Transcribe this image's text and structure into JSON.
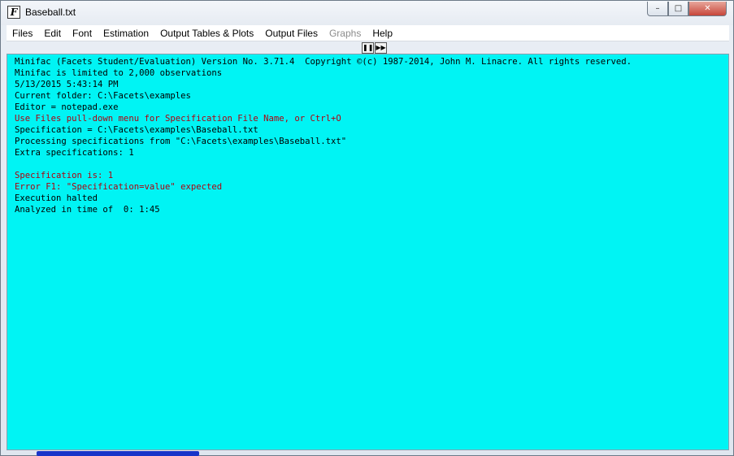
{
  "window": {
    "title": "Baseball.txt",
    "icon_letter": "F"
  },
  "titlebar_buttons": {
    "minimize": "–",
    "maximize": "□",
    "close": "✕"
  },
  "menu": {
    "items": [
      {
        "label": "Files",
        "enabled": true
      },
      {
        "label": "Edit",
        "enabled": true
      },
      {
        "label": "Font",
        "enabled": true
      },
      {
        "label": "Estimation",
        "enabled": true
      },
      {
        "label": "Output Tables & Plots",
        "enabled": true
      },
      {
        "label": "Output Files",
        "enabled": true
      },
      {
        "label": "Graphs",
        "enabled": false
      },
      {
        "label": "Help",
        "enabled": true
      }
    ]
  },
  "controls": {
    "pause": "❚❚",
    "fast_forward": "▶▶"
  },
  "colors": {
    "output_background": "#00f4f4",
    "text_default": "#000000",
    "text_error": "#b0000e"
  },
  "output": {
    "lines": [
      {
        "text": "Minifac (Facets Student/Evaluation) Version No. 3.71.4  Copyright ©(c) 1987-2014, John M. Linacre. All rights reserved.",
        "color": "black"
      },
      {
        "text": "Minifac is limited to 2,000 observations",
        "color": "black"
      },
      {
        "text": "5/13/2015 5:43:14 PM",
        "color": "black"
      },
      {
        "text": "Current folder: C:\\Facets\\examples",
        "color": "black"
      },
      {
        "text": "Editor = notepad.exe",
        "color": "black"
      },
      {
        "text": "Use Files pull-down menu for Specification File Name, or Ctrl+O",
        "color": "red"
      },
      {
        "text": "Specification = C:\\Facets\\examples\\Baseball.txt",
        "color": "black"
      },
      {
        "text": "Processing specifications from \"C:\\Facets\\examples\\Baseball.txt\"",
        "color": "black"
      },
      {
        "text": "Extra specifications: 1",
        "color": "black"
      },
      {
        "text": "",
        "color": "black"
      },
      {
        "text": "Specification is: 1",
        "color": "red"
      },
      {
        "text": "Error F1: \"Specification=value\" expected",
        "color": "red"
      },
      {
        "text": "Execution halted",
        "color": "black"
      },
      {
        "text": "Analyzed in time of  0: 1:45",
        "color": "black"
      }
    ]
  }
}
